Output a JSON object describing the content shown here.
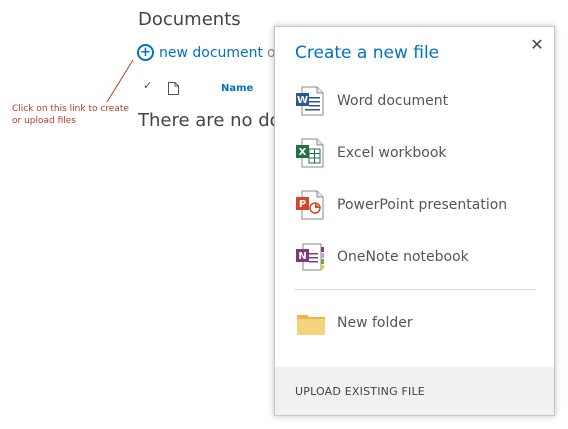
{
  "page": {
    "title": "Documents",
    "new_document_label": "new document",
    "new_document_tail": "o",
    "columns": {
      "check": "✓",
      "name": "Name"
    },
    "empty_message": "There are no do"
  },
  "annotation": {
    "text": "Click on this link to create or upload files",
    "color": "#c0392b"
  },
  "popup": {
    "title": "Create a new file",
    "close_label": "✕",
    "items": [
      {
        "label": "Word document",
        "icon": "word-icon",
        "color": "#2b579a",
        "letter": "W"
      },
      {
        "label": "Excel workbook",
        "icon": "excel-icon",
        "color": "#217346",
        "letter": "X"
      },
      {
        "label": "PowerPoint presentation",
        "icon": "powerpoint-icon",
        "color": "#d24726",
        "letter": "P"
      },
      {
        "label": "OneNote notebook",
        "icon": "onenote-icon",
        "color": "#80397b",
        "letter": "N"
      },
      {
        "label": "New folder",
        "icon": "folder-icon",
        "color": "#f2c96b"
      }
    ],
    "upload_label": "UPLOAD EXISTING FILE"
  },
  "colors": {
    "accent": "#0072c6"
  }
}
